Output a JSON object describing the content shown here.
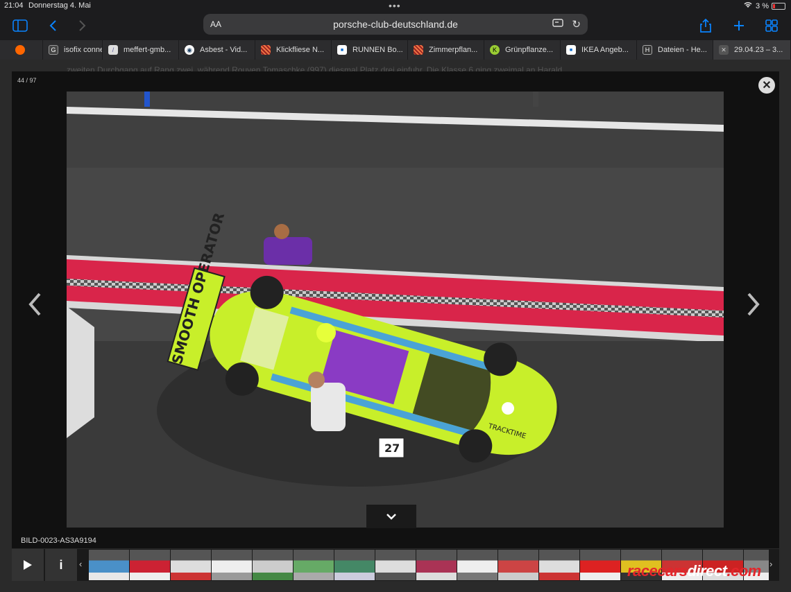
{
  "status": {
    "time": "21:04",
    "date": "Donnerstag 4. Mai",
    "battery": "3 %"
  },
  "toolbar": {
    "text_size": "AA",
    "url": "porsche-club-deutschland.de",
    "accent": "#0a84ff"
  },
  "tabs": [
    {
      "label": "",
      "icon": "orange-icon"
    },
    {
      "label": "isofix conne",
      "icon": "google-icon"
    },
    {
      "label": "meffert-gmb...",
      "icon": "meffert-icon"
    },
    {
      "label": "Asbest - Vid...",
      "icon": "asbest-icon"
    },
    {
      "label": "Klickfliese N...",
      "icon": "pattern-icon"
    },
    {
      "label": "RUNNEN Bo...",
      "icon": "ikea-icon"
    },
    {
      "label": "Zimmerpflan...",
      "icon": "pattern-icon"
    },
    {
      "label": "Grünpflanze...",
      "icon": "k-icon"
    },
    {
      "label": "IKEA Angeb...",
      "icon": "ikea-icon"
    },
    {
      "label": "Dateien - He...",
      "icon": "h-icon"
    },
    {
      "label": "29.04.23 – 3...",
      "icon": "close-icon"
    }
  ],
  "behind_text": "zweiten Durchgang auf Rang zwei, während Rouven Tomaschke (997) diesmal Platz drei einfuhr. Die Klasse 6 ging zweimal an Harald",
  "lightbox": {
    "counter": "44 / 97",
    "caption": "BILD-0023-AS3A9194",
    "photo_subject": "Porsche GT race car in pit lane",
    "car_livery_text": "SMOOTH OPERATOR",
    "car_number": "27",
    "sponsor": "TRACKTIME",
    "thumbnail_count": 17
  },
  "watermark": {
    "part_a": "racecars",
    "part_b": "direct",
    "part_c": ".com"
  }
}
